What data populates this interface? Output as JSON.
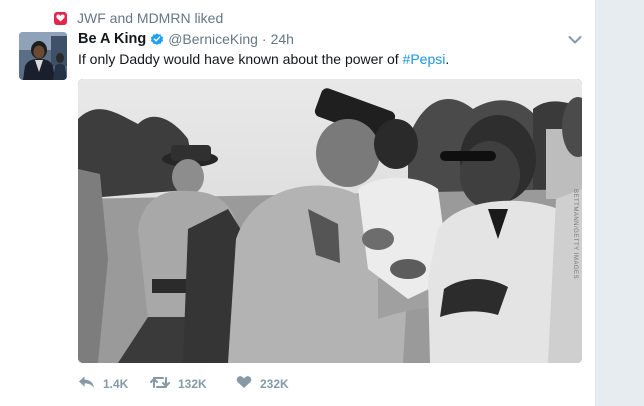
{
  "context": {
    "text": "JWF and MDMRN liked"
  },
  "user": {
    "name": "Be A King",
    "handle": "@BerniceKing",
    "time": "24h"
  },
  "tweet": {
    "text_prefix": "If only Daddy would have known about the power of ",
    "hashtag": "#Pepsi",
    "text_suffix": "."
  },
  "media": {
    "watermark": "BETTMANN/GETTY IMAGES"
  },
  "actions": {
    "replies": "1.4K",
    "retweets": "132K",
    "likes": "232K"
  },
  "colors": {
    "like_badge": "#e2264d",
    "verified": "#1da1f2",
    "hashtag": "#1b95e0",
    "meta_text": "#657786",
    "action_icons": "#8899a6"
  }
}
